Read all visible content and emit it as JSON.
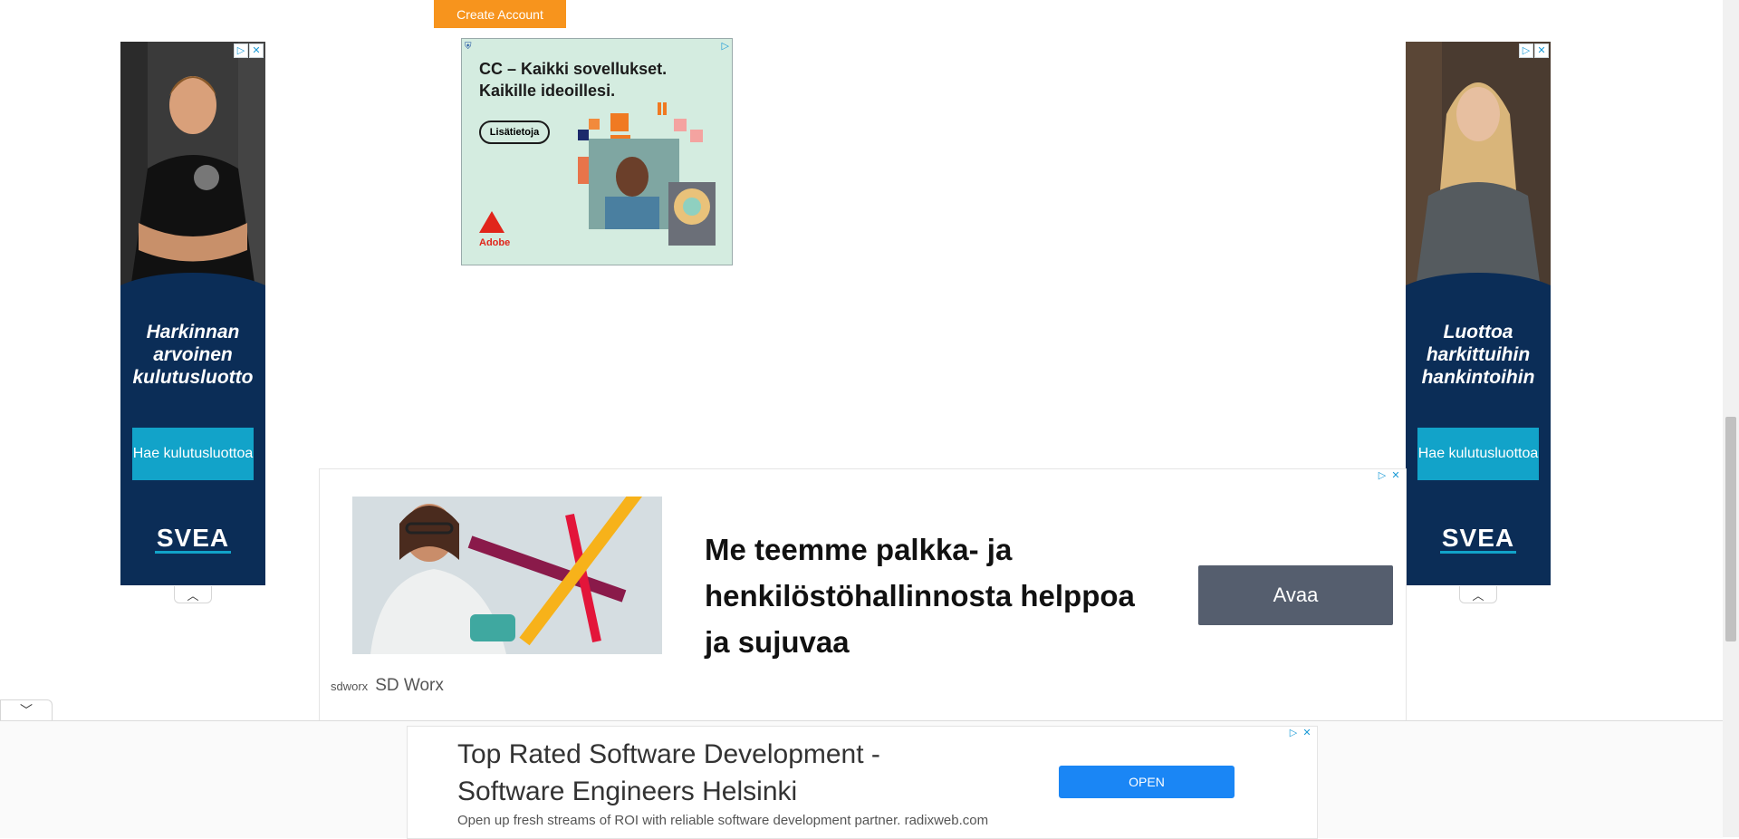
{
  "top": {
    "create_account_label": "Create Account"
  },
  "left_ad": {
    "headline": "Harkinnan arvoinen kulutusluotto",
    "cta": "Hae kulutusluottoa",
    "brand": "SVEA"
  },
  "right_ad": {
    "headline": "Luottoa harkittuihin hankintoihin",
    "cta": "Hae kulutusluottoa",
    "brand": "SVEA"
  },
  "adobe_ad": {
    "title_line1": "CC – Kaikki sovellukset.",
    "title_line2": "Kaikille ideoillesi.",
    "button": "Lisätietoja",
    "brand": "Adobe"
  },
  "sdworx_ad": {
    "headline": "Me teemme palkka- ja henkilöstöhallinnosta helppoa ja sujuvaa",
    "open_label": "Avaa",
    "brand_mark": "sdworx",
    "brand_name": "SD Worx"
  },
  "bottom_ad": {
    "headline": "Top Rated Software Development - Software Engineers Helsinki",
    "description": "Open up fresh streams of ROI with reliable software development partner. radixweb.com",
    "open_label": "OPEN"
  },
  "colors": {
    "accent_orange": "#f7941d",
    "svea_navy": "#0b2d57",
    "svea_cyan": "#12a3c9",
    "open_blue": "#1a86f5"
  }
}
